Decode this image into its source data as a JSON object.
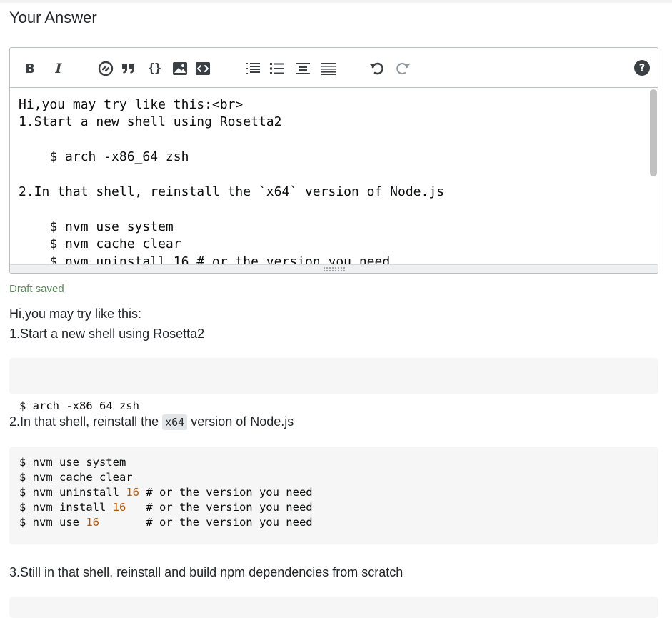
{
  "page": {
    "title": "Your Answer"
  },
  "toolbar": {
    "bold": "B",
    "italic": "I",
    "code": "{}",
    "help": "?"
  },
  "editor": {
    "lines": [
      "Hi,you may try like this:<br>",
      "1.Start a new shell using Rosetta2",
      "",
      "    $ arch -x86_64 zsh",
      "",
      "2.In that shell, reinstall the `x64` version of Node.js",
      "",
      "    $ nvm use system",
      "    $ nvm cache clear",
      "    $ nvm uninstall 16 # or the version you need"
    ]
  },
  "status": {
    "draft": "Draft saved"
  },
  "preview": {
    "p1_line1": "Hi,you may try like this:",
    "p1_line2": "1.Start a new shell using Rosetta2",
    "code1": "$ arch -x86_64 zsh",
    "p2_before": "2.In that shell, reinstall the ",
    "p2_code": "x64",
    "p2_after": " version of Node.js",
    "code2": [
      {
        "cmd": "$ nvm use system",
        "num": "",
        "comment": ""
      },
      {
        "cmd": "$ nvm cache clear",
        "num": "",
        "comment": ""
      },
      {
        "cmd": "$ nvm uninstall ",
        "num": "16",
        "comment": " # or the version you need"
      },
      {
        "cmd": "$ nvm install ",
        "num": "16",
        "comment": "   # or the version you need"
      },
      {
        "cmd": "$ nvm use ",
        "num": "16",
        "comment": "       # or the version you need"
      }
    ],
    "p3": "3.Still in that shell, reinstall and build npm dependencies from scratch"
  },
  "colors": {
    "accent_draft": "#5b8a5e",
    "number": "#b75301",
    "code_bg": "#f6f6f6"
  }
}
